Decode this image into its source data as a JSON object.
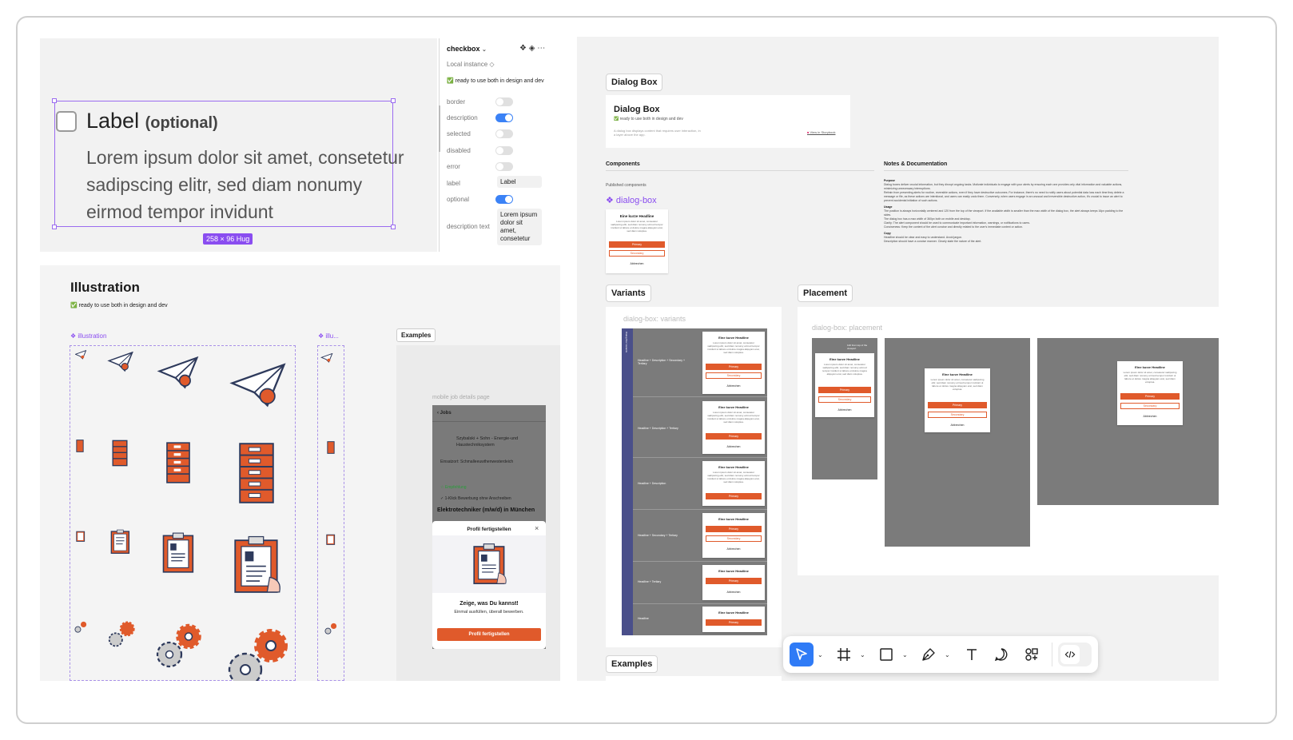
{
  "component_panel": {
    "label": "Label",
    "label_optional": "(optional)",
    "body": "Lorem ipsum dolor sit amet, consetetur sadipscing elitr, sed diam nonumy eirmod tempor invidunt",
    "dimension_tag": "258 × 96 Hug"
  },
  "properties": {
    "component_name": "checkbox",
    "instance_type": "Local instance",
    "status": "ready to use both in design and dev",
    "rows": [
      {
        "label": "border",
        "on": false
      },
      {
        "label": "description",
        "on": true
      },
      {
        "label": "selected",
        "on": false
      },
      {
        "label": "disabled",
        "on": false
      },
      {
        "label": "error",
        "on": false
      }
    ],
    "label_row": "label",
    "label_value": "Label",
    "optional_row": "optional",
    "optional_on": true,
    "desc_text_row": "description text",
    "desc_text_value": "Lorem ipsum dolor sit amet, consetetur"
  },
  "illustration_panel": {
    "title": "Illustration",
    "status": "ready to use both in design and dev",
    "component_a": "illustration",
    "component_b": "illu...",
    "examples_label": "Examples",
    "example_caption": "mobile job details page",
    "phone": {
      "back": "Jobs",
      "company": "Szybalski + Sohn - Energie-und Haustechniksystem",
      "location": "Einsatzort: Schmalleeuwthenwesterdeich",
      "badge": "Empfehlung",
      "quick_apply": "1-Klick Bewerbung ohne Anschreiben",
      "job_title": "Elektrotechniker (m/w/d) in München",
      "sheet_title": "Profil fertigstellen",
      "sheet_heading": "Zeige, was Du kannst!",
      "sheet_sub": "Einmal ausfüllen, überall bewerben.",
      "sheet_button": "Profil fertigstellen"
    }
  },
  "dialog_panel": {
    "pill_title": "Dialog Box",
    "card_title": "Dialog Box",
    "card_status": "ready to use both in design and dev",
    "card_desc": "A dialog box displays content that requires user interaction, in a layer above the app.",
    "card_link": "View in Storybook",
    "components_label": "Components",
    "notes_label": "Notes & Documentation",
    "published_label": "Published components",
    "component_name": "dialog-box",
    "dialog_headline": "Eine kurze Headline",
    "dialog_body": "Lorem ipsum dolor sit amet, consetetur sadipscing elitr, sed diam nonumy eirmod tempor invidunt ut labore et dolore magna aliquyam erat, sed diam voluptua.",
    "btn_primary": "Primary",
    "btn_secondary": "Secondary",
    "btn_tertiary": "Abbrechen",
    "variants_label": "Variants",
    "variants_caption": "dialog-box: variants",
    "variants_side": "Dialog Box Variants",
    "variant_rows": [
      "Headline + Description + Secondary + Tertiary",
      "Headline + Description + Tertiary",
      "Headline + Description",
      "Headline + Secondary + Tertiary",
      "Headline + Tertiary",
      "Headline"
    ],
    "placement_label": "Placement",
    "placement_caption": "dialog-box: placement",
    "placement_note": "120 from top of the viewport",
    "examples_label": "Examples",
    "notes": [
      "Purpose",
      "Dialog boxes deliver crucial information, but they disrupt ongoing tasks. Motivate individuals to engage with your alerts by ensuring each one provides only vital information and valuable actions, minimizing unnecessary interruptions.",
      "Refrain from presenting alerts for routine, reversible actions, even if they have destructive outcomes. For instance, there's no need to notify users about potential data loss each time they delete a message or file, as these actions are intentional, and users can easily undo them. Conversely, when users engage in an unusual and irreversible destructive action, it's crucial to issue an alert to prevent accidental initiation of such actions.",
      "Usage",
      "The position is always horizontally centered and 120 from the top of the viewport. If the available width is smaller than the max width of the dialog box, the alert always keeps 16px padding to the sides.",
      "The dialog box has a max width of 360px both on mobile and desktop.",
      "Clarity: The alert component should be used to communicate important information, warnings, or notifications to users.",
      "Conciseness: Keep the content of the alert concise and directly related to the user's immediate context or action.",
      "Copy",
      "Headline should be clear and easy to understand. Avoid jargon.",
      "Description should have a concise manner. Clearly state the nature of the alert."
    ]
  },
  "toolbar": {
    "tools": [
      "move-tool",
      "frame-tool",
      "shape-tool",
      "pen-tool",
      "text-tool",
      "comment-tool",
      "components-tool",
      "dev-mode-toggle"
    ]
  },
  "colors": {
    "accent": "#8a4df0",
    "toggle_on": "#3b82f6",
    "brand_orange": "#e05a2b",
    "illustration_navy": "#2e3a5c"
  }
}
